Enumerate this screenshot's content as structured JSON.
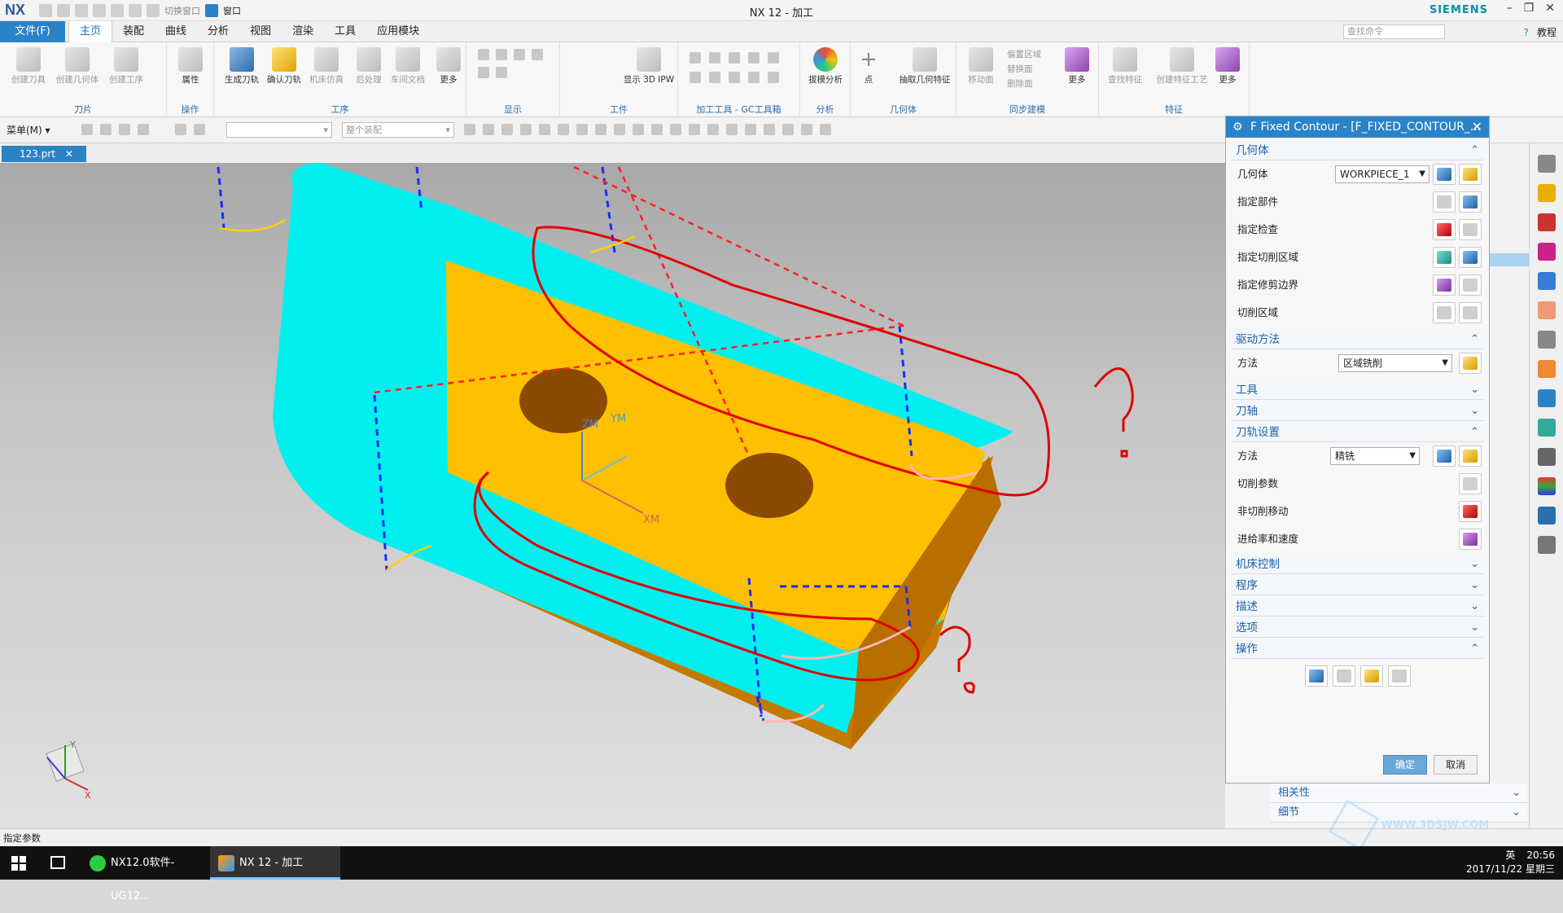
{
  "window": {
    "title": "NX 12 - 加工",
    "logo": "NX",
    "brand": "SIEMENS",
    "quick_access_label1": "切换窗口",
    "quick_access_label2": "窗口"
  },
  "menubar": {
    "file_tab": "文件(F)",
    "items": [
      "主页",
      "装配",
      "曲线",
      "分析",
      "视图",
      "渲染",
      "工具",
      "应用模块"
    ],
    "search_placeholder": "查找命令",
    "help_label": "教程"
  },
  "ribbon": {
    "groups": [
      {
        "label": "刀片",
        "buttons": [
          "创建刀具",
          "创建几何体",
          "创建工序"
        ]
      },
      {
        "label": "操作",
        "buttons": [
          "属性"
        ]
      },
      {
        "label": "工序",
        "buttons": [
          "生成刀轨",
          "确认刀轨",
          "机床仿真",
          "后处理",
          "车间文档",
          "更多"
        ]
      },
      {
        "label": "显示",
        "buttons": []
      },
      {
        "label": "工件",
        "buttons": [
          "显示 3D IPW"
        ]
      },
      {
        "label": "加工工具 - GC工具箱",
        "buttons": []
      },
      {
        "label": "分析",
        "buttons": [
          "拔模分析"
        ]
      },
      {
        "label": "几何体",
        "buttons": [
          "点",
          "抽取几何特征"
        ]
      },
      {
        "label": "同步建模",
        "buttons": [
          "移动面",
          "偏置区域",
          "替换面",
          "删除面",
          "更多"
        ]
      },
      {
        "label": "特征",
        "buttons": [
          "查找特征",
          "创建特征工艺",
          "更多"
        ]
      }
    ]
  },
  "toolbar2": {
    "menu_label": "菜单(M)",
    "combo2_placeholder": "整个装配"
  },
  "document_tab": "123.prt",
  "dialog": {
    "title": "F Fixed Contour - [F_FIXED_CONTOUR_...",
    "sections": {
      "geometry": {
        "header": "几何体",
        "geometry_label": "几何体",
        "geometry_value": "WORKPIECE_1",
        "rows": [
          "指定部件",
          "指定检查",
          "指定切削区域",
          "指定修剪边界",
          "切削区域"
        ]
      },
      "drive": {
        "header": "驱动方法",
        "method_label": "方法",
        "method_value": "区域铣削"
      },
      "tool": {
        "header": "工具"
      },
      "axis": {
        "header": "刀轴"
      },
      "path": {
        "header": "刀轨设置",
        "method_label": "方法",
        "method_value": "精铣",
        "rows": [
          "切削参数",
          "非切削移动",
          "进给率和速度"
        ]
      },
      "machine": {
        "header": "机床控制"
      },
      "program": {
        "header": "程序"
      },
      "description": {
        "header": "描述"
      },
      "options": {
        "header": "选项"
      },
      "actions": {
        "header": "操作"
      }
    },
    "ok": "确定",
    "cancel": "取消"
  },
  "lower_panel": {
    "items": [
      "相关性",
      "细节"
    ]
  },
  "status": "指定参数",
  "viewport_labels": {
    "ym": "YM",
    "xm": "XM",
    "zm": "ZM",
    "triad_y": "Y",
    "triad_x": "X"
  },
  "taskbar": {
    "items": [
      "NX12.0软件-UG12...",
      "NX 12 - 加工"
    ],
    "time": "20:56",
    "date": "2017/11/22 星期三",
    "ime": "英"
  },
  "watermark": "WWW.3DSJW.COM",
  "colors": {
    "accent": "#2a83c6",
    "cyan_surface": "#00ffff",
    "orange_surface": "#ffc000",
    "markup_red": "#e00000"
  }
}
